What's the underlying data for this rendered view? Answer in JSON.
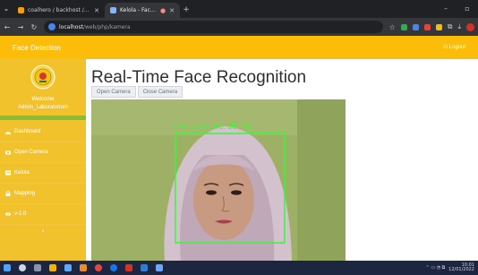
{
  "browser": {
    "tabs": [
      {
        "label": "coalhero / backhost / scl / scl"
      },
      {
        "label": "Kelola - Face Detection"
      }
    ],
    "address": {
      "host": "localhost",
      "path": "/web/php/kamera"
    },
    "window_controls": [
      "–",
      "▫",
      "✕"
    ]
  },
  "app": {
    "brand": "Face Detection",
    "logout": "Logout",
    "accent": "#fbbc0a"
  },
  "sidebar": {
    "welcome": "Welcome",
    "user": "Admin_Laboratorium",
    "items": [
      {
        "label": "Dashboard",
        "icon": "dashboard-icon"
      },
      {
        "label": "Open Camera",
        "icon": "camera-icon"
      },
      {
        "label": "Kelola",
        "icon": "kelola-icon"
      },
      {
        "label": "Mapping",
        "icon": "lock-icon"
      },
      {
        "label": "v-1.0",
        "icon": "eye-icon"
      }
    ]
  },
  "main": {
    "title": "Real-Time Face Recognition",
    "open_camera": "Open Camera",
    "close_camera": "Close Camera",
    "detection_label": "Denisa  (score: 35.19)"
  },
  "taskbar": {
    "time": "10:01",
    "date": "12/01/2022"
  }
}
